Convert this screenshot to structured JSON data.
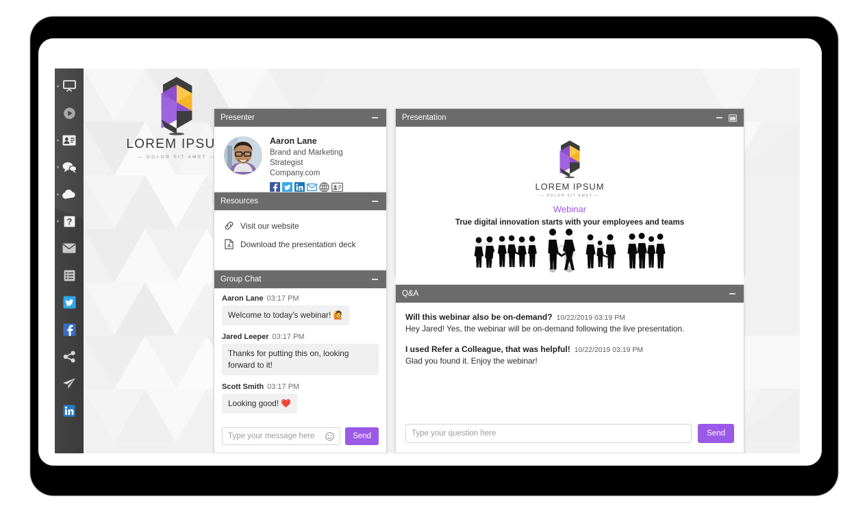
{
  "brand": {
    "name": "LOREM IPSUM",
    "tagline": "— DOLOR SIT AMET —",
    "logo_colors": {
      "purple": "#8e4fd1",
      "gold": "#f5b425",
      "dark": "#3d3d3d"
    }
  },
  "sidebar": {
    "items": [
      {
        "name": "projector-screen-icon",
        "label": "Presentation",
        "has_dot": true,
        "style": "plain"
      },
      {
        "name": "play-circle-icon",
        "label": "Media player",
        "has_dot": false,
        "style": "plain"
      },
      {
        "name": "id-card-icon",
        "label": "Speaker bio",
        "has_dot": true,
        "style": "plain"
      },
      {
        "name": "chat-bubbles-icon",
        "label": "Group chat",
        "has_dot": true,
        "style": "plain"
      },
      {
        "name": "cloud-icon",
        "label": "Resources",
        "has_dot": true,
        "style": "plain"
      },
      {
        "name": "question-mark-icon",
        "label": "Q and A",
        "has_dot": true,
        "style": "plain"
      },
      {
        "name": "envelope-icon",
        "label": "Email",
        "has_dot": false,
        "style": "plain"
      },
      {
        "name": "list-icon",
        "label": "Agenda",
        "has_dot": false,
        "style": "plain"
      },
      {
        "name": "twitter-icon",
        "label": "Twitter",
        "has_dot": false,
        "style": "twitter",
        "color": "#2fa8e8"
      },
      {
        "name": "facebook-icon",
        "label": "Facebook",
        "has_dot": false,
        "style": "facebook",
        "color": "#3a6ec4"
      },
      {
        "name": "share-icon",
        "label": "Share",
        "has_dot": false,
        "style": "plain"
      },
      {
        "name": "paper-plane-icon",
        "label": "Send",
        "has_dot": false,
        "style": "plain"
      },
      {
        "name": "linkedin-icon",
        "label": "LinkedIn",
        "has_dot": false,
        "style": "linkedin",
        "color": "#2a7bc4"
      }
    ]
  },
  "presenter_panel": {
    "title": "Presenter",
    "minimize_label": "Minimize",
    "name": "Aaron Lane",
    "role": "Brand and Marketing Strategist",
    "company": "Company.com",
    "social": [
      {
        "name": "facebook-icon",
        "color": "#3b5998"
      },
      {
        "name": "twitter-icon",
        "color": "#35a9e8"
      },
      {
        "name": "linkedin-icon",
        "color": "#1878b5"
      },
      {
        "name": "email-icon",
        "color": "#3a9ad9"
      },
      {
        "name": "globe-icon",
        "color": "#6e6e6e"
      },
      {
        "name": "vcard-icon",
        "color": "#6e6e6e"
      }
    ]
  },
  "resources_panel": {
    "title": "Resources",
    "minimize_label": "Minimize",
    "items": [
      {
        "icon": "link-icon",
        "label": "Visit our website"
      },
      {
        "icon": "pdf-file-icon",
        "label": "Download the presentation deck"
      }
    ]
  },
  "chat_panel": {
    "title": "Group Chat",
    "minimize_label": "Minimize",
    "messages": [
      {
        "author": "Aaron Lane",
        "time": "03:17 PM",
        "text": "Welcome to today's webinar! 🙋"
      },
      {
        "author": "Jared Leeper",
        "time": "03:17 PM",
        "text": "Thanks for putting this on, looking forward to it!"
      },
      {
        "author": "Scott Smith",
        "time": "03:17 PM",
        "text": "Looking good! ❤️"
      }
    ],
    "input_placeholder": "Type your message here",
    "emoji_icon": "smiley-icon",
    "send_label": "Send"
  },
  "presentation_panel": {
    "title": "Presentation",
    "minimize_label": "Minimize",
    "maximize_label": "Maximize",
    "slide": {
      "brand": "LOREM IPSUM",
      "tagline": "— DOLOR SIT AMET —",
      "kicker": "Webinar",
      "kicker_color": "#9b59e8",
      "subtitle": "True digital innovation starts with your employees and teams",
      "artwork": "people-silhouettes-group"
    }
  },
  "qa_panel": {
    "title": "Q&A",
    "minimize_label": "Minimize",
    "entries": [
      {
        "question": "Will this webinar also be on-demand?",
        "time": "10/22/2019 03:19 PM",
        "answer": "Hey Jared! Yes, the webinar will be on-demand following the live presentation."
      },
      {
        "question": "I used Refer a Colleague, that was helpful!",
        "time": "10/22/2019 03:19 PM",
        "answer": "Glad you found it. Enjoy the webinar!"
      }
    ],
    "input_placeholder": "Type your question here",
    "send_label": "Send"
  },
  "theme": {
    "panel_header_bg": "#6b6b6b",
    "sidebar_bg": "#414141",
    "accent_purple": "#9b59e8",
    "canvas_bg": "#f2f2f2"
  }
}
